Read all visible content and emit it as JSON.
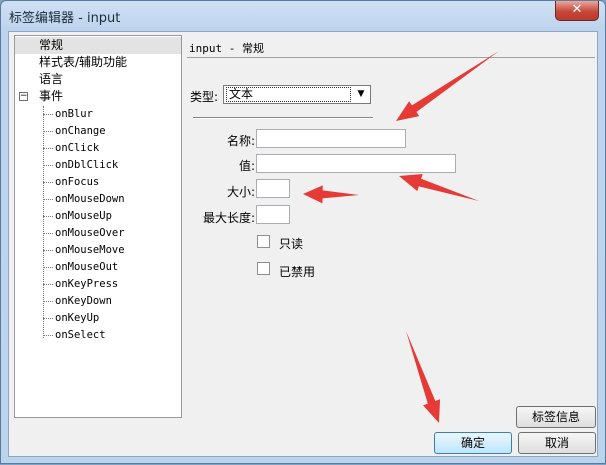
{
  "window": {
    "title": "标签编辑器 - input",
    "close_glyph": "✕"
  },
  "tree": {
    "items": [
      {
        "label": "常规",
        "selected": true
      },
      {
        "label": "样式表/辅助功能"
      },
      {
        "label": "语言"
      },
      {
        "label": "事件",
        "expander": "⊟"
      }
    ],
    "events": [
      "onBlur",
      "onChange",
      "onClick",
      "onDblClick",
      "onFocus",
      "onMouseDown",
      "onMouseUp",
      "onMouseOver",
      "onMouseMove",
      "onMouseOut",
      "onKeyPress",
      "onKeyDown",
      "onKeyUp",
      "onSelect"
    ]
  },
  "main": {
    "header": "input - 常规",
    "type_label": "类型:",
    "type_value": "文本",
    "fields": {
      "name_label": "名称:",
      "value_label": "值:",
      "size_label": "大小:",
      "maxlength_label": "最大长度:",
      "name_value": "",
      "value_value": "",
      "size_value": "",
      "maxlength_value": ""
    },
    "readonly_label": "只读",
    "disabled_label": "已禁用"
  },
  "footer": {
    "tag_info_label": "标签信息",
    "ok_label": "确定",
    "cancel_label": "取消"
  },
  "annotation_color": "#e53a36"
}
